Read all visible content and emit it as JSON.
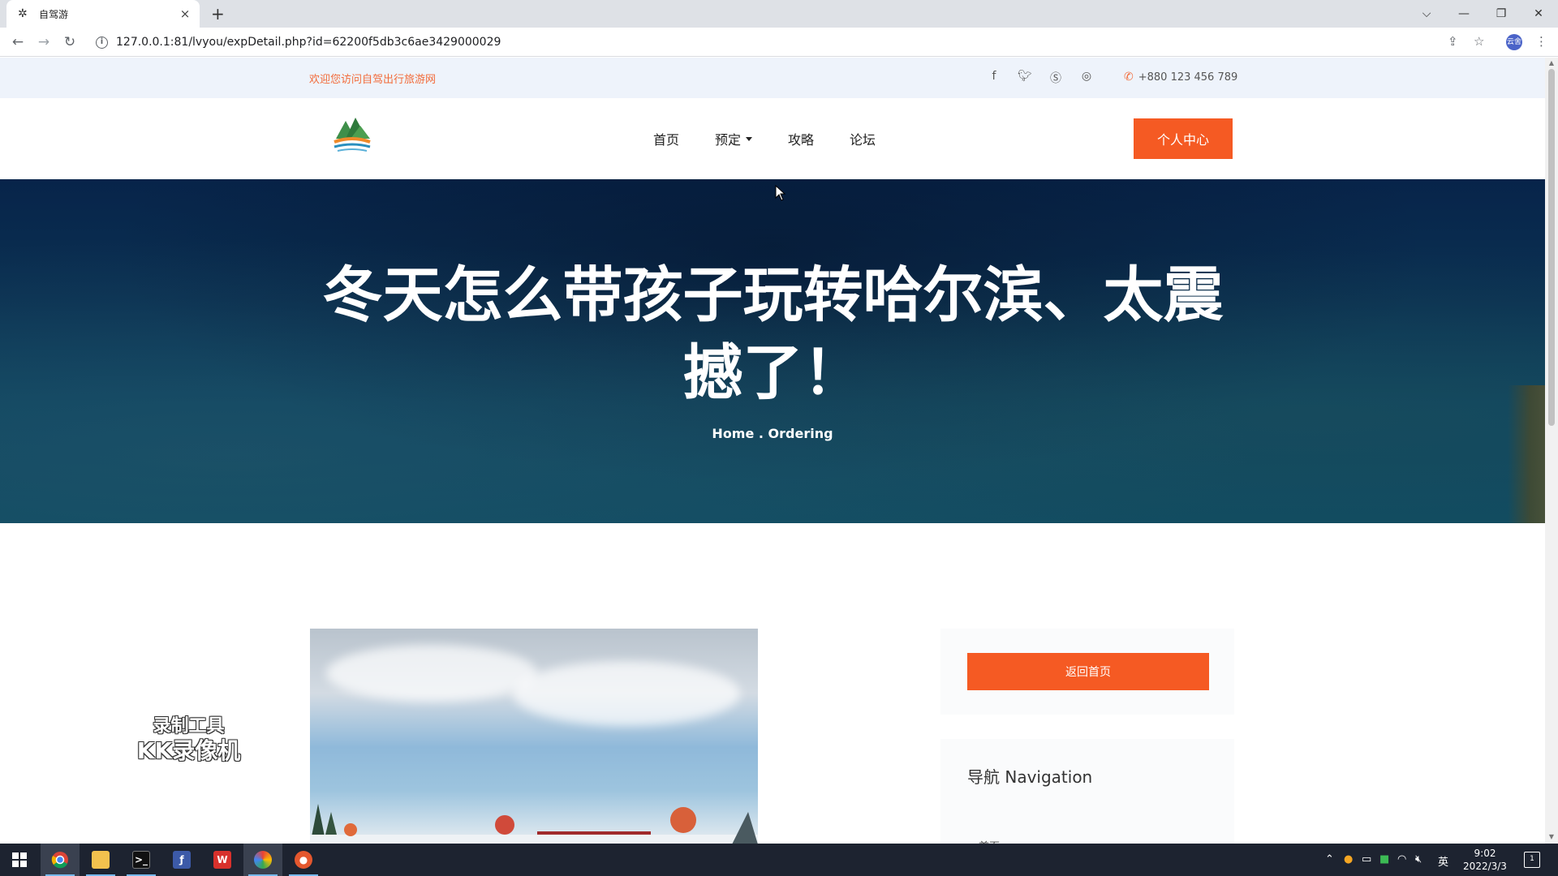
{
  "browser": {
    "tab_title": "自驾游",
    "tab_close": "×",
    "new_tab": "+",
    "url": "127.0.0.1:81/lvyou/expDetail.php?id=62200f5db3c6ae3429000029",
    "profile_label": "云舍"
  },
  "topbar": {
    "welcome": "欢迎您访问自驾出行旅游网",
    "phone": "+880 123 456 789"
  },
  "nav": {
    "items": [
      {
        "label": "首页"
      },
      {
        "label": "预定"
      },
      {
        "label": "攻略"
      },
      {
        "label": "论坛"
      }
    ],
    "cta": "个人中心"
  },
  "hero": {
    "title": "冬天怎么带孩子玩转哈尔滨、太震撼了！",
    "crumb_home": "Home",
    "crumb_sep": " . ",
    "crumb_current": "Ordering"
  },
  "sidebar": {
    "back_button": "返回首页",
    "nav_heading": "导航 Navigation",
    "first_link": "首页"
  },
  "watermark": {
    "line1": "录制工具",
    "line2": "KK录像机"
  },
  "taskbar": {
    "ime": "英",
    "time": "9:02",
    "date": "2022/3/3",
    "notif_count": "1"
  },
  "colors": {
    "accent": "#f55a23",
    "welcome_text": "#f26b3a",
    "hero_dark": "#07244a",
    "topbar_bg": "#eef3fb"
  }
}
